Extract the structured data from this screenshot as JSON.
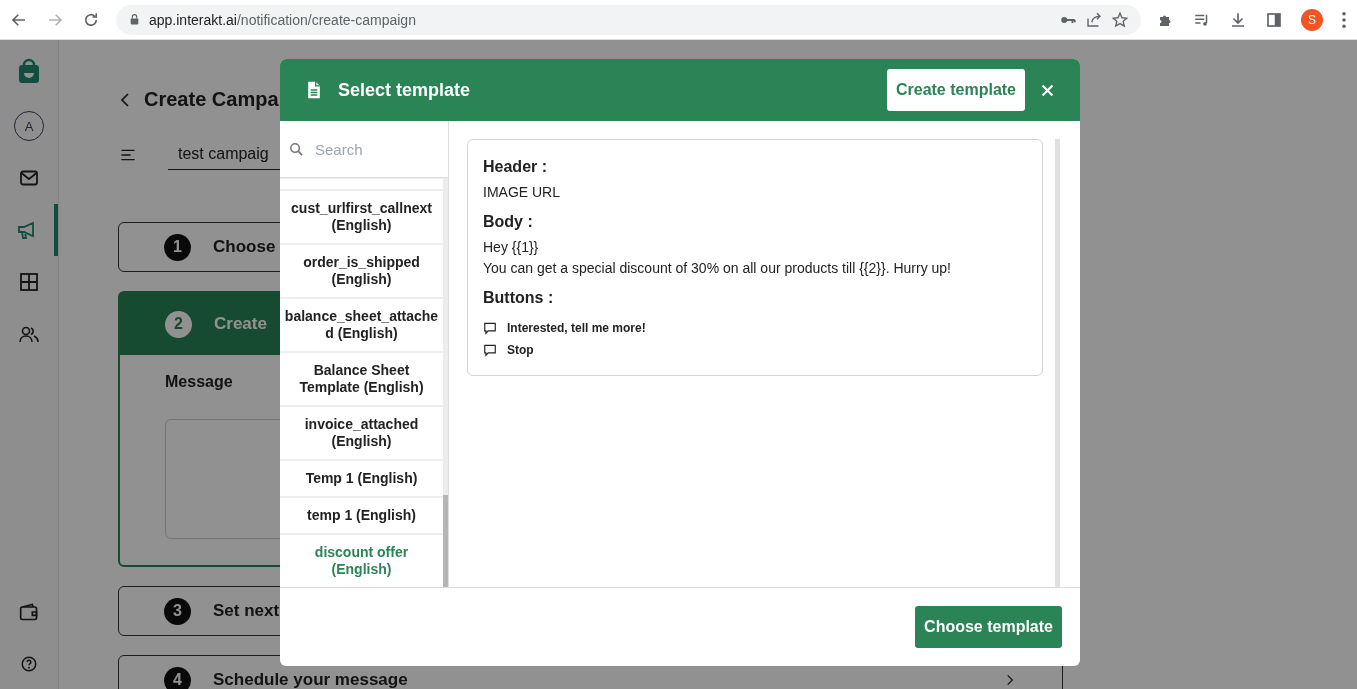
{
  "browser": {
    "url_host": "app.interakt.ai",
    "url_path": "/notification/create-campaign",
    "profile_initial": "S"
  },
  "sidebar": {
    "avatar": "A",
    "items": [
      {
        "kind": "mail",
        "selected": false
      },
      {
        "kind": "megaphone",
        "selected": true
      },
      {
        "kind": "grid",
        "selected": false
      },
      {
        "kind": "users",
        "selected": false
      }
    ]
  },
  "page": {
    "title": "Create Campa",
    "campaign_name": "test campaig",
    "message_label": "Message",
    "steps": [
      {
        "number": "1",
        "label": "Choose",
        "expanded": false
      },
      {
        "number": "2",
        "label": "Create",
        "expanded": true
      },
      {
        "number": "3",
        "label": "Set next",
        "expanded": false
      },
      {
        "number": "4",
        "label": "Schedule your message",
        "expanded": false
      }
    ]
  },
  "modal": {
    "title": "Select template",
    "create_button": "Create template",
    "search_placeholder": "Search",
    "templates": [
      {
        "name": "cust_urlfirst_callnext (English)",
        "selected": false
      },
      {
        "name": "order_is_shipped (English)",
        "selected": false
      },
      {
        "name": "balance_sheet_attached (English)",
        "selected": false
      },
      {
        "name": "Balance Sheet Template (English)",
        "selected": false
      },
      {
        "name": "invoice_attached (English)",
        "selected": false
      },
      {
        "name": "Temp 1 (English)",
        "selected": false
      },
      {
        "name": "temp 1 (English)",
        "selected": false
      },
      {
        "name": "discount offer (English)",
        "selected": true
      }
    ],
    "preview": {
      "header_label": "Header :",
      "header_value": "IMAGE URL",
      "body_label": "Body :",
      "body_lines": [
        "Hey {{1}}",
        "You can get a special discount of 30% on all our products till {{2}}. Hurry up!"
      ],
      "buttons_label": "Buttons :",
      "buttons": [
        "Interested, tell me more!",
        "Stop"
      ]
    },
    "choose_button": "Choose template"
  }
}
